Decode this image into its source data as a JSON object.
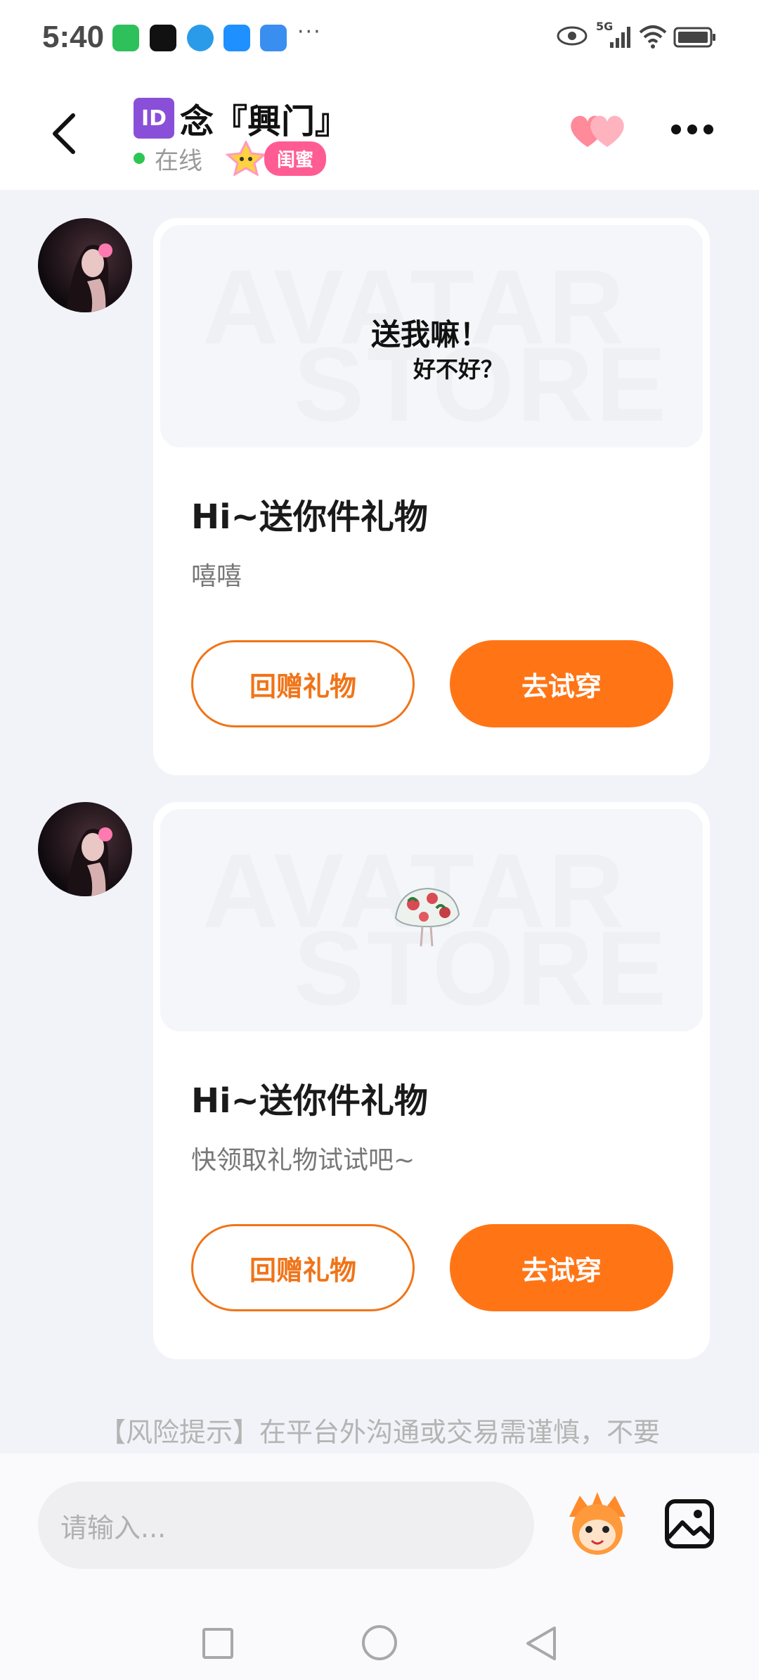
{
  "status_bar": {
    "time": "5:40",
    "more_indicator": "···",
    "network": "5G",
    "app_icons": [
      "wechat-icon",
      "tiktok-icon",
      "browser-icon",
      "message-icon",
      "weather-icon"
    ],
    "right_icons": [
      "eye-icon",
      "signal-icon",
      "wifi-icon",
      "battery-icon"
    ]
  },
  "header": {
    "id_badge": "ID",
    "title": "念『興门』",
    "online_status": "在线",
    "relation_tag": "闺蜜",
    "colors": {
      "online_dot": "#2dc653",
      "tag": "#ff5c93"
    }
  },
  "messages": [
    {
      "image_text_line1": "送我嘛！",
      "image_text_line2": "好不好？",
      "watermark_line1": "AVATAR",
      "watermark_line2": "STORE",
      "title": "Hi~送你件礼物",
      "subtitle": "嘻嘻",
      "return_gift_label": "回赠礼物",
      "try_on_label": "去试穿"
    },
    {
      "image_text_line1": "",
      "image_text_line2": "",
      "watermark_line1": "AVATAR",
      "watermark_line2": "STORE",
      "title": "Hi~送你件礼物",
      "subtitle": "快领取礼物试试吧~",
      "return_gift_label": "回赠礼物",
      "try_on_label": "去试穿"
    }
  ],
  "risk_notice": "【风险提示】在平台外沟通或交易需谨慎，不要",
  "input": {
    "placeholder": "请输入..."
  },
  "colors": {
    "accent": "#ff7516",
    "background": "#f2f3f8"
  }
}
